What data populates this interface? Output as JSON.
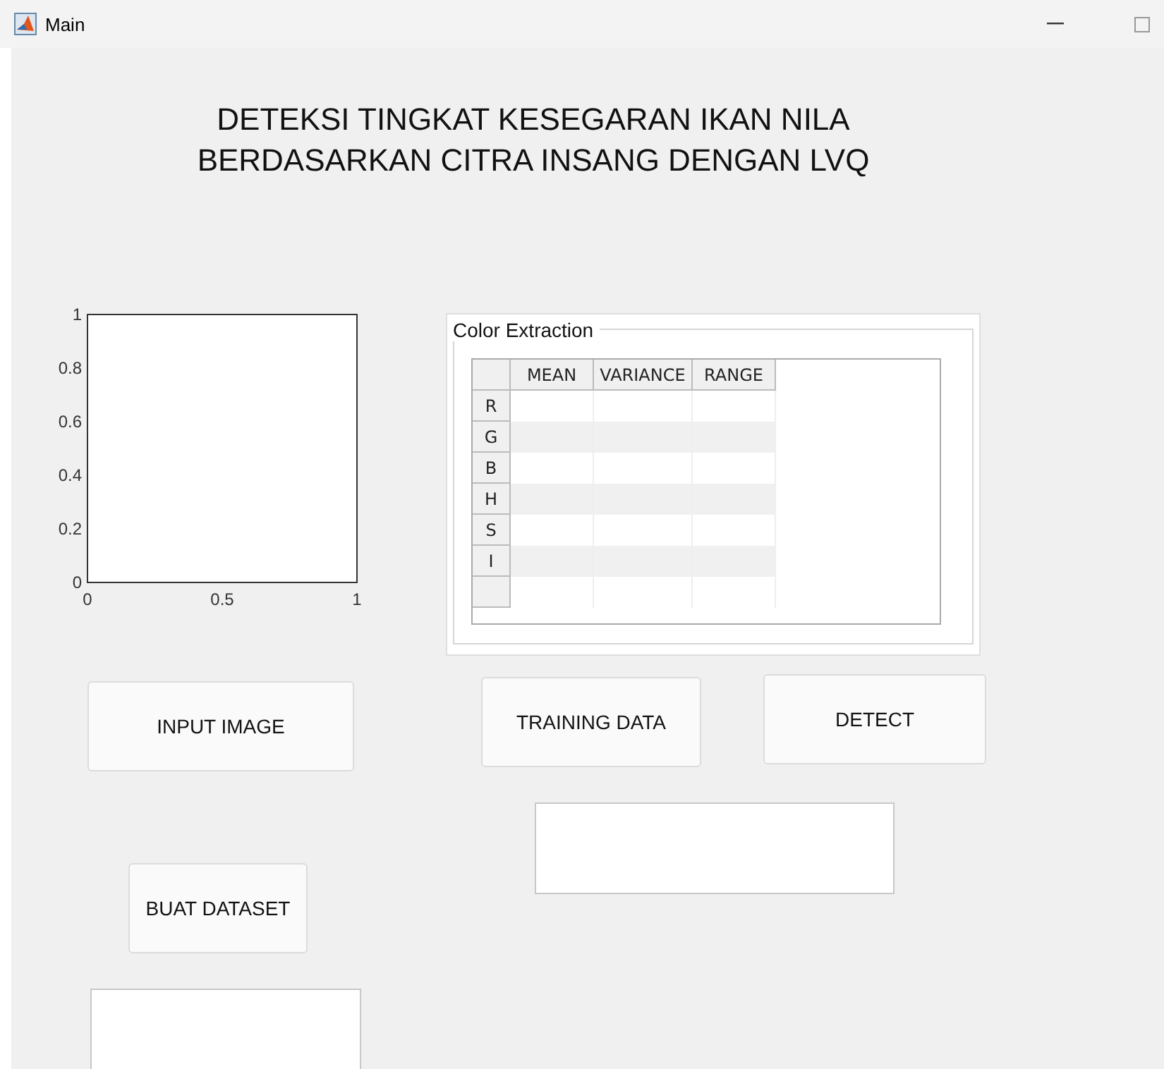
{
  "window": {
    "title": "Main"
  },
  "heading": [
    "DETEKSI TINGKAT KESEGARAN IKAN NILA",
    "BERDASARKAN CITRA INSANG DENGAN LVQ"
  ],
  "axes": {
    "chart_data": {
      "type": "line",
      "xlim": [
        0,
        1
      ],
      "ylim": [
        0,
        1
      ],
      "xticks": [
        0,
        0.5,
        1
      ],
      "yticks": [
        0,
        0.2,
        0.4,
        0.6,
        0.8,
        1
      ]
    }
  },
  "panel": {
    "title": "Color Extraction",
    "table": {
      "columns": [
        "MEAN",
        "VARIANCE",
        "RANGE"
      ],
      "rows": [
        {
          "header": "R"
        },
        {
          "header": "G"
        },
        {
          "header": "B"
        },
        {
          "header": "H"
        },
        {
          "header": "S"
        },
        {
          "header": "I"
        }
      ]
    }
  },
  "buttons": {
    "input_image": "INPUT IMAGE",
    "training_data": "TRAINING DATA",
    "detect": "DETECT",
    "buat_dataset": "BUAT DATASET"
  }
}
